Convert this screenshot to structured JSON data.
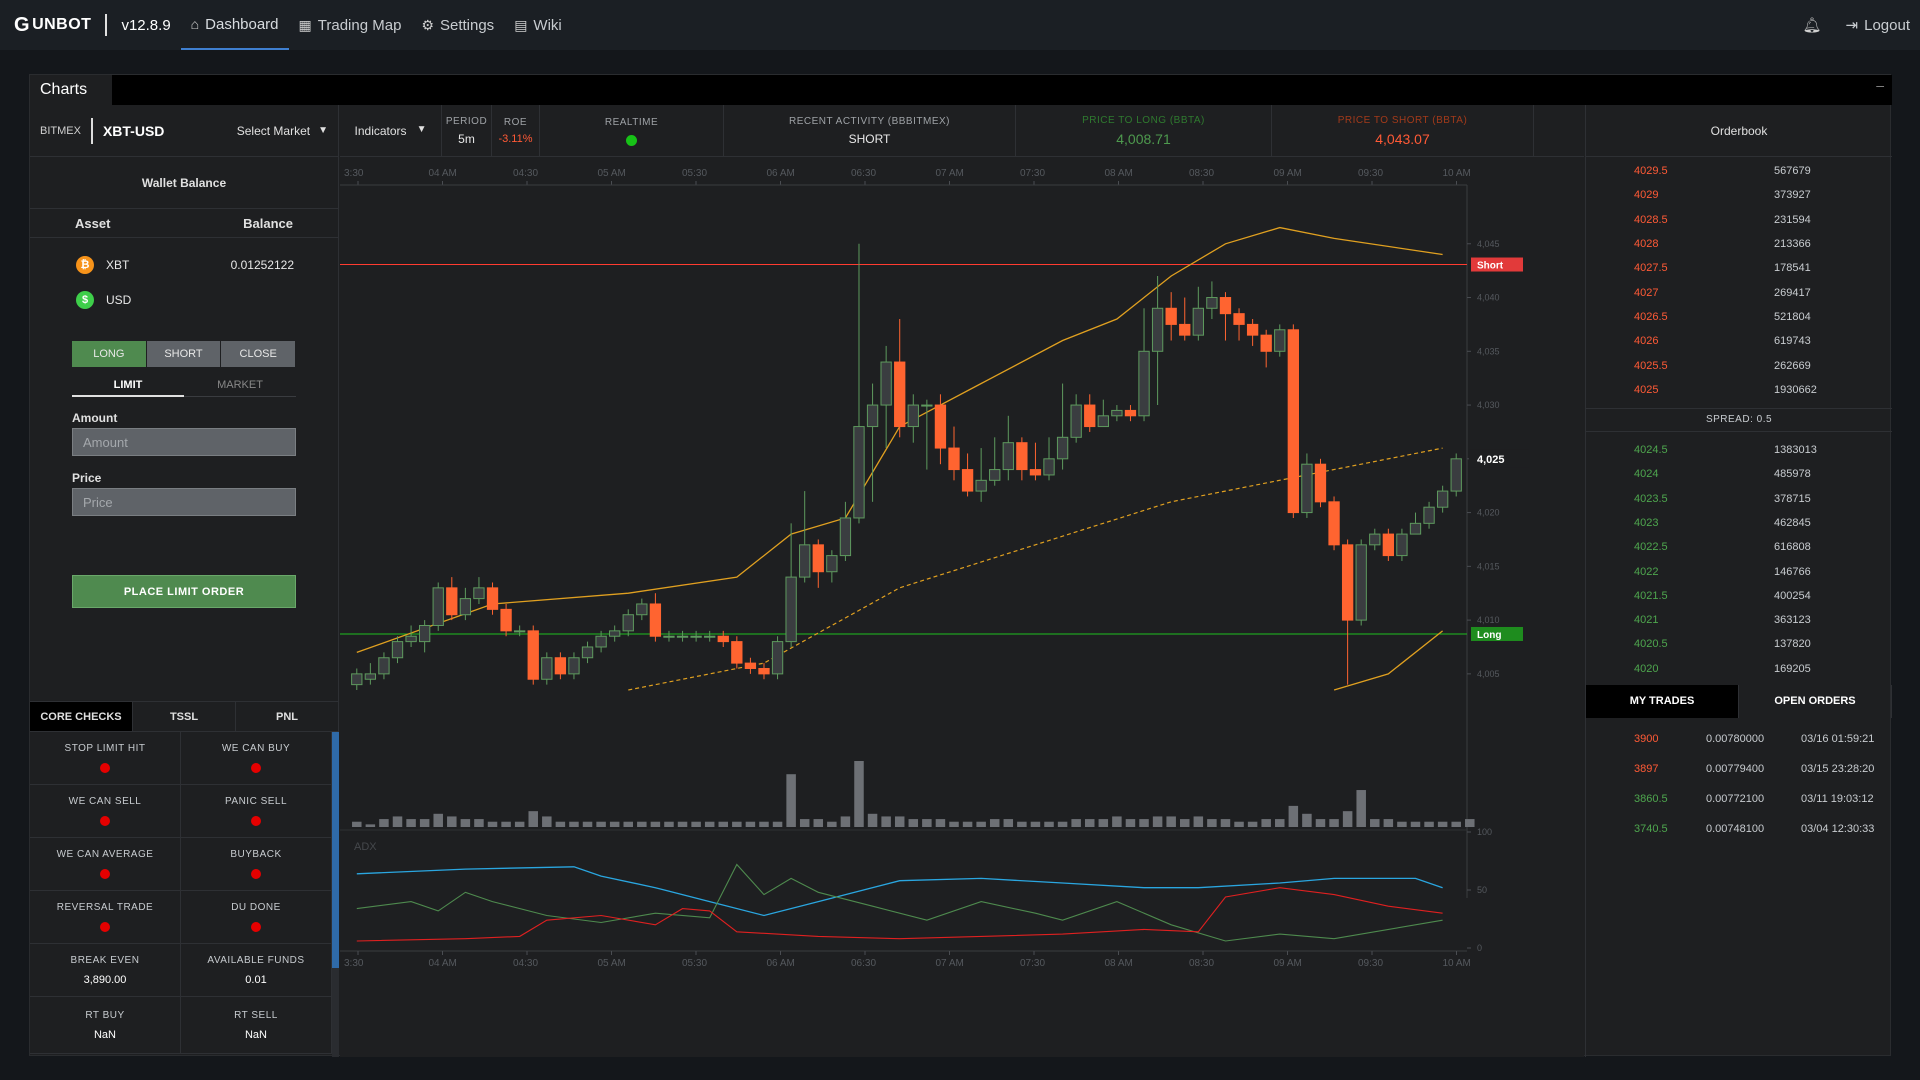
{
  "nav": {
    "brand": "UNBOT",
    "version": "v12.8.9",
    "items": [
      {
        "label": "Dashboard",
        "icon": "home-icon"
      },
      {
        "label": "Trading Map",
        "icon": "grid-icon"
      },
      {
        "label": "Settings",
        "icon": "gear-icon"
      },
      {
        "label": "Wiki",
        "icon": "book-icon"
      }
    ],
    "logout": "Logout"
  },
  "panel": {
    "title": "Charts",
    "minimize": "–"
  },
  "market": {
    "exchange": "BITMEX",
    "pair": "XBT-USD",
    "select_label": "Select Market"
  },
  "wallet": {
    "title": "Wallet Balance",
    "col_asset": "Asset",
    "col_balance": "Balance",
    "assets": [
      {
        "symbol": "XBT",
        "balance": "0.01252122",
        "icon": "bitcoin-icon",
        "color": "#f7931a"
      },
      {
        "symbol": "USD",
        "balance": "",
        "icon": "dollar-icon",
        "color": "#3ecf4a"
      }
    ]
  },
  "order": {
    "tabs": [
      "LONG",
      "SHORT",
      "CLOSE"
    ],
    "types": [
      "LIMIT",
      "MARKET"
    ],
    "amount_label": "Amount",
    "amount_placeholder": "Amount",
    "price_label": "Price",
    "price_placeholder": "Price",
    "place_button": "PLACE LIMIT ORDER"
  },
  "stats": {
    "indicators": "Indicators",
    "period_label": "PERIOD",
    "period": "5m",
    "roe_label": "ROE",
    "roe": "-3.11%",
    "realtime_label": "REALTIME",
    "activity_label": "RECENT ACTIVITY (BBBITMEX)",
    "activity": "SHORT",
    "long_label": "PRICE TO LONG (BBTA)",
    "long_value": "4,008.71",
    "short_label": "PRICE TO SHORT (BBTA)",
    "short_value": "4,043.07"
  },
  "checks": {
    "tabs": [
      "CORE CHECKS",
      "TSSL",
      "PNL"
    ],
    "rows": [
      [
        {
          "label": "STOP LIMIT HIT",
          "type": "dot"
        },
        {
          "label": "WE CAN BUY",
          "type": "dot"
        }
      ],
      [
        {
          "label": "WE CAN SELL",
          "type": "dot"
        },
        {
          "label": "PANIC SELL",
          "type": "dot"
        }
      ],
      [
        {
          "label": "WE CAN AVERAGE",
          "type": "dot"
        },
        {
          "label": "BUYBACK",
          "type": "dot"
        }
      ],
      [
        {
          "label": "REVERSAL TRADE",
          "type": "dot"
        },
        {
          "label": "DU DONE",
          "type": "dot"
        }
      ],
      [
        {
          "label": "BREAK EVEN",
          "value": "3,890.00"
        },
        {
          "label": "AVAILABLE FUNDS",
          "value": "0.01"
        }
      ],
      [
        {
          "label": "RT BUY",
          "value": "NaN"
        },
        {
          "label": "RT SELL",
          "value": "NaN"
        }
      ]
    ],
    "dot_color": "#e50000"
  },
  "orderbook": {
    "title": "Orderbook",
    "asks": [
      [
        "4029.5",
        "567679"
      ],
      [
        "4029",
        "373927"
      ],
      [
        "4028.5",
        "231594"
      ],
      [
        "4028",
        "213366"
      ],
      [
        "4027.5",
        "178541"
      ],
      [
        "4027",
        "269417"
      ],
      [
        "4026.5",
        "521804"
      ],
      [
        "4026",
        "619743"
      ],
      [
        "4025.5",
        "262669"
      ],
      [
        "4025",
        "1930662"
      ]
    ],
    "spread": "SPREAD:   0.5",
    "bids": [
      [
        "4024.5",
        "1383013"
      ],
      [
        "4024",
        "485978"
      ],
      [
        "4023.5",
        "378715"
      ],
      [
        "4023",
        "462845"
      ],
      [
        "4022.5",
        "616808"
      ],
      [
        "4022",
        "146766"
      ],
      [
        "4021.5",
        "400254"
      ],
      [
        "4021",
        "363123"
      ],
      [
        "4020.5",
        "137820"
      ],
      [
        "4020",
        "169205"
      ]
    ]
  },
  "trades": {
    "tabs": [
      "MY TRADES",
      "OPEN ORDERS"
    ],
    "rows": [
      {
        "price": "3900",
        "qty": "0.00780000",
        "time": "03/16 01:59:21",
        "side": "sell"
      },
      {
        "price": "3897",
        "qty": "0.00779400",
        "time": "03/15 23:28:20",
        "side": "sell"
      },
      {
        "price": "3860.5",
        "qty": "0.00772100",
        "time": "03/11 19:03:12",
        "side": "buy"
      },
      {
        "price": "3740.5",
        "qty": "0.00748100",
        "time": "03/04 12:30:33",
        "side": "buy"
      }
    ]
  },
  "chart_data": {
    "type": "candlestick",
    "x_ticks": [
      "3:30",
      "04 AM",
      "04:30",
      "05 AM",
      "05:30",
      "06 AM",
      "06:30",
      "07 AM",
      "07:30",
      "08 AM",
      "08:30",
      "09 AM",
      "09:30",
      "10 AM"
    ],
    "y_ticks": [
      "4,045",
      "4,040",
      "4,035",
      "4,030",
      "4,025",
      "4,020",
      "4,015",
      "4,010",
      "4,005"
    ],
    "ylim": [
      4003.5,
      4050
    ],
    "current_price_label": "4,025",
    "short_line": {
      "label": "Short",
      "value": 4043.07,
      "color": "#ff3b30"
    },
    "long_line": {
      "label": "Long",
      "value": 4008.71,
      "color": "#1fbf1f"
    },
    "candles": [
      [
        4004,
        4005,
        4003.5,
        4005.5
      ],
      [
        4004.5,
        4005,
        4004,
        4006
      ],
      [
        4005,
        4006.5,
        4004.5,
        4007
      ],
      [
        4006.5,
        4008,
        4006,
        4008.5
      ],
      [
        4008,
        4008.5,
        4007.5,
        4009.5
      ],
      [
        4008,
        4009.5,
        4007,
        4010
      ],
      [
        4009.5,
        4013,
        4009,
        4013.5
      ],
      [
        4013,
        4010.5,
        4010,
        4014
      ],
      [
        4010.5,
        4012,
        4010,
        4013
      ],
      [
        4012,
        4013,
        4011.5,
        4014
      ],
      [
        4013,
        4011,
        4010.5,
        4013.5
      ],
      [
        4011,
        4009,
        4008.5,
        4011.5
      ],
      [
        4009,
        4009,
        4008.5,
        4009.5
      ],
      [
        4009,
        4004.5,
        4004,
        4009.5
      ],
      [
        4004.5,
        4006.5,
        4004,
        4007
      ],
      [
        4006.5,
        4005,
        4004.5,
        4007
      ],
      [
        4005,
        4006.5,
        4004.5,
        4007
      ],
      [
        4006.5,
        4007.5,
        4006,
        4008
      ],
      [
        4007.5,
        4008.5,
        4007,
        4009
      ],
      [
        4008.5,
        4009,
        4008,
        4009.5
      ],
      [
        4009,
        4010.5,
        4008.5,
        4011
      ],
      [
        4010.5,
        4011.5,
        4010,
        4012
      ],
      [
        4011.5,
        4008.5,
        4008,
        4012.5
      ],
      [
        4008.5,
        4008.5,
        4008,
        4009
      ],
      [
        4008.5,
        4008.5,
        4008,
        4009
      ],
      [
        4008.5,
        4008.5,
        4008,
        4009
      ],
      [
        4008.5,
        4008.5,
        4008,
        4009
      ],
      [
        4008.5,
        4008,
        4007.5,
        4009
      ],
      [
        4008,
        4006,
        4005.5,
        4008.5
      ],
      [
        4006,
        4005.5,
        4005,
        4006.5
      ],
      [
        4005.5,
        4005,
        4004.5,
        4006
      ],
      [
        4005,
        4008,
        4004.5,
        4008.5
      ],
      [
        4008,
        4014,
        4007.5,
        4019
      ],
      [
        4014,
        4017,
        4013.5,
        4022
      ],
      [
        4017,
        4014.5,
        4013,
        4017.5
      ],
      [
        4014.5,
        4016,
        4013.5,
        4016.5
      ],
      [
        4016,
        4019.5,
        4015.5,
        4021
      ],
      [
        4019.5,
        4028,
        4019,
        4045
      ],
      [
        4028,
        4030,
        4021,
        4032
      ],
      [
        4030,
        4034,
        4026,
        4035.5
      ],
      [
        4034,
        4028,
        4027,
        4038
      ],
      [
        4028,
        4030,
        4026.5,
        4031
      ],
      [
        4030,
        4030,
        4024,
        4030.5
      ],
      [
        4030,
        4026,
        4024.5,
        4031
      ],
      [
        4026,
        4024,
        4023,
        4028
      ],
      [
        4024,
        4022,
        4021.5,
        4025.5
      ],
      [
        4022,
        4023,
        4021,
        4026
      ],
      [
        4023,
        4024,
        4022.5,
        4027
      ],
      [
        4024,
        4026.5,
        4023,
        4029
      ],
      [
        4026.5,
        4024,
        4023,
        4027
      ],
      [
        4024,
        4023.5,
        4023,
        4026.5
      ],
      [
        4023.5,
        4025,
        4023,
        4027
      ],
      [
        4025,
        4027,
        4024,
        4032
      ],
      [
        4027,
        4030,
        4026.5,
        4031
      ],
      [
        4030,
        4028,
        4027.5,
        4031
      ],
      [
        4028,
        4029,
        4028,
        4030.5
      ],
      [
        4029,
        4029.5,
        4028.5,
        4030
      ],
      [
        4029.5,
        4029,
        4028.5,
        4030
      ],
      [
        4029,
        4035,
        4028.5,
        4039
      ],
      [
        4035,
        4039,
        4030,
        4042
      ],
      [
        4039,
        4037.5,
        4036,
        4040.5
      ],
      [
        4037.5,
        4036.5,
        4036,
        4040
      ],
      [
        4036.5,
        4039,
        4036,
        4041
      ],
      [
        4039,
        4040,
        4038,
        4041.5
      ],
      [
        4040,
        4038.5,
        4036,
        4040.5
      ],
      [
        4038.5,
        4037.5,
        4036,
        4039
      ],
      [
        4037.5,
        4036.5,
        4035.5,
        4038
      ],
      [
        4036.5,
        4035,
        4033.5,
        4037
      ],
      [
        4035,
        4037,
        4034.5,
        4037.5
      ],
      [
        4037,
        4020,
        4019.5,
        4037.5
      ],
      [
        4020,
        4024.5,
        4019.5,
        4025.5
      ],
      [
        4024.5,
        4021,
        4020.5,
        4025
      ],
      [
        4021,
        4017,
        4016.5,
        4021.5
      ],
      [
        4017,
        4010,
        4004,
        4017.5
      ],
      [
        4010,
        4017,
        4009.5,
        4017.5
      ],
      [
        4017,
        4018,
        4016.5,
        4018.5
      ],
      [
        4018,
        4016,
        4015.5,
        4018.5
      ],
      [
        4016,
        4018,
        4015.5,
        4018.5
      ],
      [
        4018,
        4019,
        4018,
        4020
      ],
      [
        4019,
        4020.5,
        4018.5,
        4021
      ],
      [
        4020.5,
        4022,
        4020,
        4022.5
      ],
      [
        4022,
        4025,
        4021.5,
        4025.5
      ]
    ],
    "volume": [
      2,
      1,
      3,
      4,
      3,
      3,
      5,
      4,
      3,
      3,
      2,
      2,
      2,
      6,
      4,
      2,
      2,
      2,
      2,
      2,
      2,
      2,
      2,
      2,
      2,
      2,
      2,
      2,
      2,
      2,
      2,
      2,
      20,
      3,
      3,
      2,
      4,
      25,
      5,
      4,
      4,
      3,
      3,
      3,
      2,
      2,
      2,
      3,
      3,
      2,
      2,
      2,
      2,
      3,
      3,
      3,
      4,
      3,
      3,
      4,
      4,
      3,
      4,
      3,
      3,
      2,
      2,
      3,
      3,
      8,
      5,
      3,
      3,
      6,
      14,
      3,
      3,
      2,
      2,
      2,
      2,
      2,
      3
    ],
    "bb_upper": [
      [
        0,
        4007
      ],
      [
        10,
        4011.5
      ],
      [
        20,
        4012.5
      ],
      [
        28,
        4014
      ],
      [
        32,
        4018
      ],
      [
        36,
        4019.5
      ],
      [
        40,
        4028
      ],
      [
        46,
        4032
      ],
      [
        52,
        4036
      ],
      [
        56,
        4038
      ],
      [
        60,
        4042
      ],
      [
        64,
        4045
      ],
      [
        68,
        4046.5
      ],
      [
        72,
        4045.5
      ],
      [
        80,
        4044
      ]
    ],
    "ma": [
      [
        20,
        4003.5
      ],
      [
        30,
        4006
      ],
      [
        40,
        4013
      ],
      [
        50,
        4017
      ],
      [
        60,
        4021
      ],
      [
        70,
        4023.5
      ],
      [
        80,
        4026
      ]
    ],
    "bb_lower": [
      [
        72,
        4003.5
      ],
      [
        76,
        4005
      ],
      [
        80,
        4009
      ]
    ],
    "adx": {
      "label": "ADX",
      "y_ticks": [
        "100",
        "50",
        "0"
      ],
      "blue": [
        [
          0,
          64
        ],
        [
          8,
          68
        ],
        [
          16,
          70
        ],
        [
          18,
          62
        ],
        [
          22,
          52
        ],
        [
          26,
          40
        ],
        [
          30,
          28
        ],
        [
          34,
          40
        ],
        [
          40,
          58
        ],
        [
          46,
          60
        ],
        [
          52,
          56
        ],
        [
          58,
          52
        ],
        [
          62,
          52
        ],
        [
          68,
          56
        ],
        [
          72,
          60
        ],
        [
          78,
          60
        ],
        [
          80,
          52
        ]
      ],
      "green": [
        [
          0,
          34
        ],
        [
          4,
          40
        ],
        [
          6,
          32
        ],
        [
          8,
          48
        ],
        [
          10,
          40
        ],
        [
          14,
          28
        ],
        [
          18,
          22
        ],
        [
          22,
          30
        ],
        [
          26,
          26
        ],
        [
          28,
          72
        ],
        [
          30,
          46
        ],
        [
          32,
          60
        ],
        [
          34,
          48
        ],
        [
          38,
          36
        ],
        [
          42,
          24
        ],
        [
          46,
          40
        ],
        [
          50,
          30
        ],
        [
          52,
          24
        ],
        [
          56,
          40
        ],
        [
          60,
          20
        ],
        [
          64,
          6
        ],
        [
          68,
          12
        ],
        [
          72,
          8
        ],
        [
          80,
          24
        ]
      ],
      "red": [
        [
          0,
          6
        ],
        [
          8,
          8
        ],
        [
          12,
          10
        ],
        [
          14,
          24
        ],
        [
          18,
          28
        ],
        [
          22,
          20
        ],
        [
          24,
          34
        ],
        [
          26,
          32
        ],
        [
          28,
          14
        ],
        [
          34,
          10
        ],
        [
          40,
          8
        ],
        [
          46,
          10
        ],
        [
          52,
          12
        ],
        [
          58,
          16
        ],
        [
          62,
          14
        ],
        [
          64,
          44
        ],
        [
          68,
          52
        ],
        [
          72,
          46
        ],
        [
          76,
          36
        ],
        [
          80,
          30
        ]
      ]
    }
  }
}
